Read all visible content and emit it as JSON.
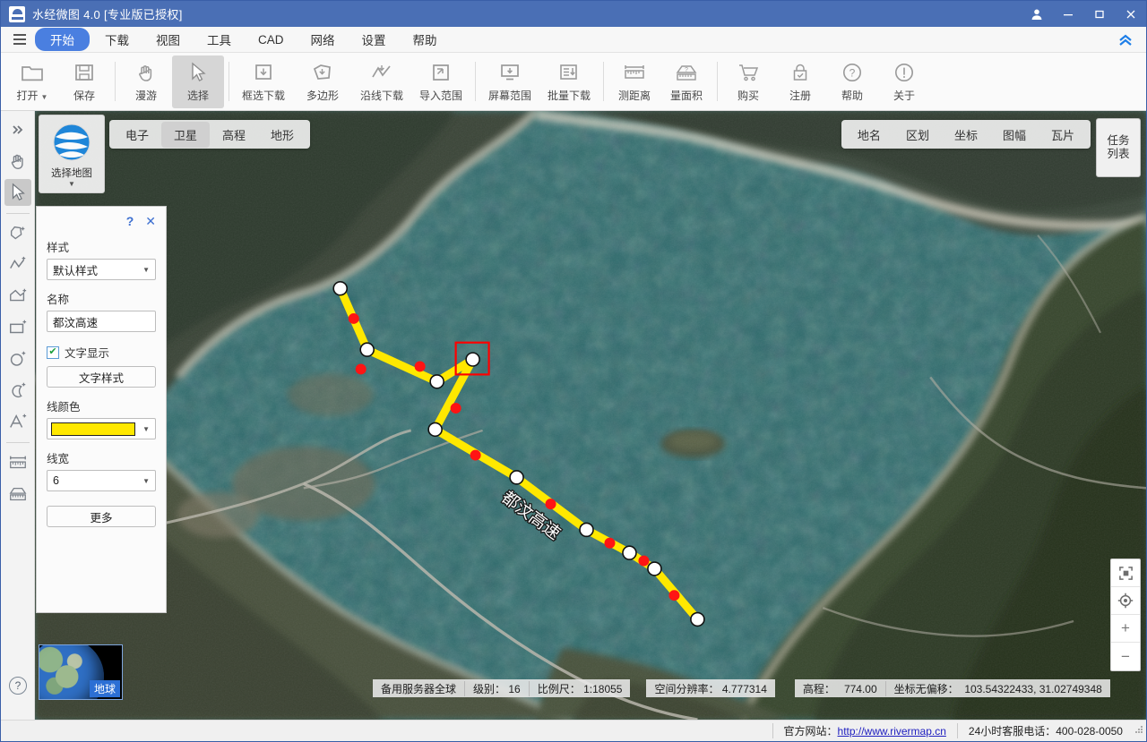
{
  "titlebar": {
    "app_title": "水经微图 4.0 [专业版已授权]",
    "logo_icon": "app-logo-icon",
    "user_icon": "user-icon",
    "minimize_icon": "minimize-icon",
    "maximize_icon": "maximize-icon",
    "close_icon": "close-icon",
    "accent": "#4a6fb5"
  },
  "menubar": {
    "hamburger_icon": "hamburger-icon",
    "collapse_icon": "chevron-double-up-icon",
    "items": [
      {
        "label": "开始",
        "active": true
      },
      {
        "label": "下载",
        "active": false
      },
      {
        "label": "视图",
        "active": false
      },
      {
        "label": "工具",
        "active": false
      },
      {
        "label": "CAD",
        "active": false
      },
      {
        "label": "网络",
        "active": false
      },
      {
        "label": "设置",
        "active": false
      },
      {
        "label": "帮助",
        "active": false
      }
    ]
  },
  "ribbon": {
    "items": [
      {
        "label": "打开",
        "icon": "folder-open-icon",
        "caret": true,
        "selected": false
      },
      {
        "label": "保存",
        "icon": "save-disk-icon",
        "caret": false,
        "selected": false
      },
      {
        "sep": true
      },
      {
        "label": "漫游",
        "icon": "pan-hand-icon",
        "caret": false,
        "selected": false
      },
      {
        "label": "选择",
        "icon": "cursor-arrow-icon",
        "caret": false,
        "selected": true
      },
      {
        "sep": true
      },
      {
        "label": "框选下载",
        "icon": "rect-download-icon",
        "caret": false,
        "selected": false
      },
      {
        "label": "多边形",
        "icon": "polygon-download-icon",
        "caret": false,
        "selected": false
      },
      {
        "label": "沿线下载",
        "icon": "polyline-download-icon",
        "caret": false,
        "selected": false
      },
      {
        "label": "导入范围",
        "icon": "import-range-icon",
        "caret": false,
        "selected": false
      },
      {
        "sep": true
      },
      {
        "label": "屏幕范围",
        "icon": "screen-download-icon",
        "caret": false,
        "selected": false
      },
      {
        "label": "批量下载",
        "icon": "batch-download-icon",
        "caret": false,
        "selected": false
      },
      {
        "sep": true
      },
      {
        "label": "测距离",
        "icon": "ruler-distance-icon",
        "caret": false,
        "selected": false
      },
      {
        "label": "量面积",
        "icon": "measure-area-icon",
        "caret": false,
        "selected": false
      },
      {
        "sep": true
      },
      {
        "label": "购买",
        "icon": "cart-icon",
        "caret": false,
        "selected": false
      },
      {
        "label": "注册",
        "icon": "lock-check-icon",
        "caret": false,
        "selected": false
      },
      {
        "label": "帮助",
        "icon": "help-circle-icon",
        "caret": false,
        "selected": false
      },
      {
        "label": "关于",
        "icon": "info-circle-icon",
        "caret": false,
        "selected": false
      }
    ]
  },
  "vertical_toolbar": {
    "items": [
      {
        "icon": "expand-right-icon",
        "name": "expand-toolbar",
        "selected": false
      },
      {
        "icon": "pan-hand-icon",
        "name": "pan-tool",
        "selected": false
      },
      {
        "icon": "cursor-arrow-icon",
        "name": "select-tool",
        "selected": true
      },
      {
        "sep": true
      },
      {
        "icon": "add-polygon-icon",
        "name": "add-polygon-tool",
        "selected": false
      },
      {
        "icon": "add-polyline-icon",
        "name": "add-polyline-tool",
        "selected": false
      },
      {
        "icon": "add-area-icon",
        "name": "add-area-tool",
        "selected": false
      },
      {
        "icon": "add-rectangle-icon",
        "name": "add-rectangle-tool",
        "selected": false
      },
      {
        "icon": "add-circle-icon",
        "name": "add-circle-tool",
        "selected": false
      },
      {
        "icon": "add-arc-icon",
        "name": "add-arc-tool",
        "selected": false
      },
      {
        "icon": "add-text-icon",
        "name": "add-text-tool",
        "selected": false
      },
      {
        "sep": true
      },
      {
        "icon": "measure-distance-icon",
        "name": "measure-distance-tool",
        "selected": false
      },
      {
        "icon": "measure-area-icon",
        "name": "measure-area-tool",
        "selected": false
      }
    ],
    "help_icon": "help-circle-icon"
  },
  "map_ui": {
    "select_map_label": "选择地图",
    "select_map_icon": "globe-earth-icon",
    "layer_tabs": [
      {
        "label": "电子",
        "active": false
      },
      {
        "label": "卫星",
        "active": true
      },
      {
        "label": "高程",
        "active": false
      },
      {
        "label": "地形",
        "active": false
      }
    ],
    "overlay_tabs": [
      {
        "label": "地名",
        "active": false
      },
      {
        "label": "区划",
        "active": false
      },
      {
        "label": "坐标",
        "active": false
      },
      {
        "label": "图幅",
        "active": false
      },
      {
        "label": "瓦片",
        "active": false
      }
    ],
    "task_list_label": "任务列表",
    "controls": [
      {
        "icon": "fullscreen-icon",
        "name": "fullscreen-button"
      },
      {
        "icon": "compass-locate-icon",
        "name": "locate-button"
      },
      {
        "icon": "zoom-in-icon",
        "name": "zoom-in-button",
        "glyph": "+"
      },
      {
        "icon": "zoom-out-icon",
        "name": "zoom-out-button",
        "glyph": "−"
      }
    ],
    "globe_thumb_label": "地球",
    "route_label": "都汶高速",
    "route_color": "#ffe800",
    "vertex_color": "#ffffff",
    "midpoint_color": "#ff1414",
    "selection_box_color": "#ff0000",
    "water_color": "#2e6b6c"
  },
  "properties_panel": {
    "help_glyph": "?",
    "close_glyph": "✕",
    "style_label": "样式",
    "style_value": "默认样式",
    "name_label": "名称",
    "name_value": "都汶高速",
    "name_placeholder": "名称",
    "text_show_label": "文字显示",
    "text_show_checked": true,
    "text_style_button": "文字样式",
    "line_color_label": "线颜色",
    "line_color_value": "#ffe800",
    "line_width_label": "线宽",
    "line_width_value": "6",
    "more_button": "更多"
  },
  "statusbar": {
    "server": "备用服务器全球",
    "level_label": "级别：",
    "level_value": "16",
    "scale_label": "比例尺：",
    "scale_value": "1:18055",
    "resolution_label": "空间分辨率：",
    "resolution_value": "4.777314",
    "elevation_label": "高程：",
    "elevation_value": "774.00",
    "coord_label": "坐标无偏移：",
    "coord_value": "103.54322433, 31.02749348"
  },
  "footer": {
    "site_label": "官方网站：",
    "site_url": "http://www.rivermap.cn",
    "hotline": "24小时客服电话：400-028-0050"
  }
}
